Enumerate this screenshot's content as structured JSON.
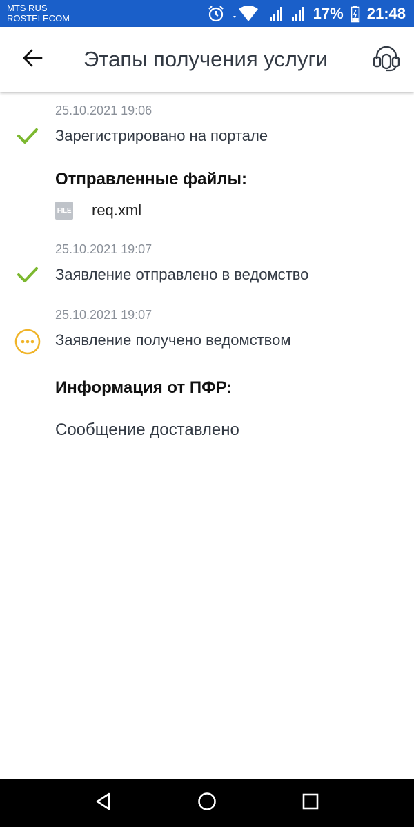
{
  "status_bar": {
    "carrier_line1": "MTS RUS",
    "carrier_line2": "ROSTELECOM",
    "battery": "17%",
    "time": "21:48",
    "icons": [
      "alarm-icon",
      "wifi-icon",
      "signal-icon",
      "signal-icon",
      "battery-icon"
    ],
    "background": "#1a5fc9"
  },
  "header": {
    "title": "Этапы получения услуги",
    "back_icon": "arrow-left-icon",
    "support_icon": "headset-icon"
  },
  "stages": [
    {
      "date": "25.10.2021 19:06",
      "text": "Зарегистрировано на портале",
      "status": "done",
      "icon": "check-icon",
      "color": "#7cb82f"
    },
    {
      "date": "25.10.2021 19:07",
      "text": "Заявление отправлено в ведомство",
      "status": "done",
      "icon": "check-icon",
      "color": "#7cb82f"
    },
    {
      "date": "25.10.2021 19:07",
      "text": "Заявление получено ведомством",
      "status": "pending",
      "icon": "more-horizontal-circle-icon",
      "color": "#f0b429"
    }
  ],
  "files_section": {
    "title": "Отправленные файлы:",
    "files": [
      {
        "icon_label": "FILE",
        "name": "req.xml"
      }
    ]
  },
  "info_section": {
    "title": "Информация от ПФР:",
    "message": "Сообщение доставлено"
  },
  "nav_bar": {
    "buttons": [
      "back-triangle-icon",
      "home-circle-icon",
      "recents-square-icon"
    ]
  }
}
